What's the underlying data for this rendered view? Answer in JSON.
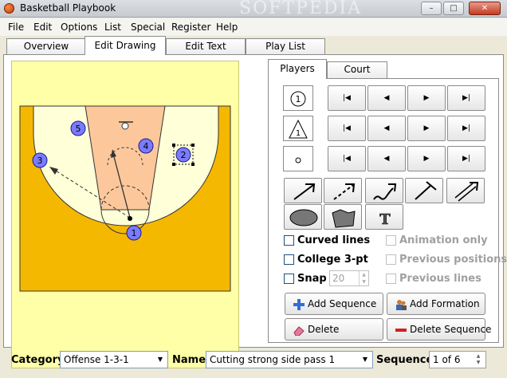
{
  "window": {
    "title": "Basketball Playbook",
    "watermark": "SOFTPEDIA",
    "controls": {
      "minimize": "–",
      "maximize": "□",
      "close": "✕"
    }
  },
  "menu": [
    "File",
    "Edit",
    "Options",
    "List",
    "Special",
    "Register",
    "Help"
  ],
  "tabs": {
    "overview": "Overview",
    "edit_drawing": "Edit Drawing",
    "edit_text": "Edit Text",
    "play_list": "Play List"
  },
  "subtabs": {
    "players": "Players",
    "court": "Court"
  },
  "court": {
    "players": [
      {
        "num": "1"
      },
      {
        "num": "2"
      },
      {
        "num": "3"
      },
      {
        "num": "4"
      },
      {
        "num": "5"
      }
    ],
    "colors": {
      "outside": "#ffffa8",
      "floor": "#f5b800",
      "arc_fill": "#ffffd8",
      "lane": "#fcc89b",
      "player": "#7b7bff"
    }
  },
  "player_icons": {
    "circle_label": "1",
    "triangle_label": "1"
  },
  "nav_glyphs": {
    "first": "|◀",
    "prev": "◀",
    "next": "▶",
    "last": "▶|"
  },
  "tool_glyphs": {
    "text_tool": "T"
  },
  "checkboxes": {
    "curved_lines": "Curved lines",
    "college_3pt": "College 3-pt",
    "snap": "Snap",
    "animation_only": "Animation only",
    "previous_positions": "Previous positions",
    "previous_lines": "Previous lines"
  },
  "snap_value": "20",
  "buttons": {
    "add_sequence": "Add Sequence",
    "add_formation": "Add Formation",
    "delete": "Delete",
    "delete_sequence": "Delete Sequence"
  },
  "bottom": {
    "category_label": "Category",
    "category_value": "Offense 1-3-1",
    "name_label": "Name",
    "name_value": "Cutting strong side pass 1",
    "sequence_label": "Sequence",
    "sequence_value": "1 of 6"
  }
}
